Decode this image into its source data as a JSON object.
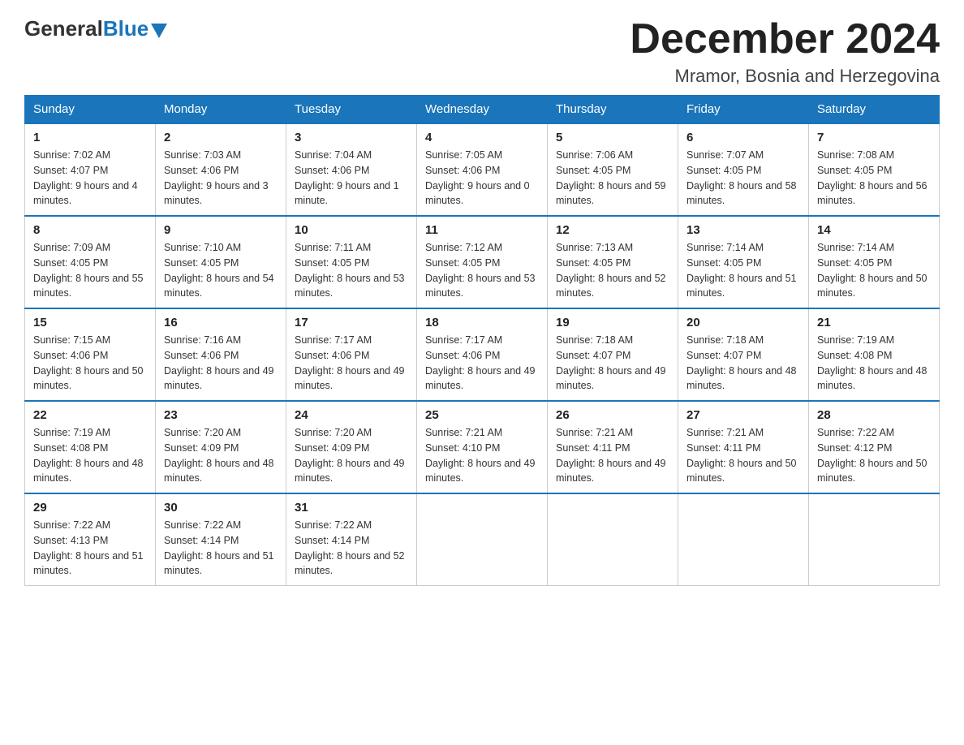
{
  "header": {
    "logo_general": "General",
    "logo_blue": "Blue",
    "month_title": "December 2024",
    "location": "Mramor, Bosnia and Herzegovina"
  },
  "days_of_week": [
    "Sunday",
    "Monday",
    "Tuesday",
    "Wednesday",
    "Thursday",
    "Friday",
    "Saturday"
  ],
  "weeks": [
    [
      {
        "day": "1",
        "sunrise": "7:02 AM",
        "sunset": "4:07 PM",
        "daylight": "9 hours and 4 minutes."
      },
      {
        "day": "2",
        "sunrise": "7:03 AM",
        "sunset": "4:06 PM",
        "daylight": "9 hours and 3 minutes."
      },
      {
        "day": "3",
        "sunrise": "7:04 AM",
        "sunset": "4:06 PM",
        "daylight": "9 hours and 1 minute."
      },
      {
        "day": "4",
        "sunrise": "7:05 AM",
        "sunset": "4:06 PM",
        "daylight": "9 hours and 0 minutes."
      },
      {
        "day": "5",
        "sunrise": "7:06 AM",
        "sunset": "4:05 PM",
        "daylight": "8 hours and 59 minutes."
      },
      {
        "day": "6",
        "sunrise": "7:07 AM",
        "sunset": "4:05 PM",
        "daylight": "8 hours and 58 minutes."
      },
      {
        "day": "7",
        "sunrise": "7:08 AM",
        "sunset": "4:05 PM",
        "daylight": "8 hours and 56 minutes."
      }
    ],
    [
      {
        "day": "8",
        "sunrise": "7:09 AM",
        "sunset": "4:05 PM",
        "daylight": "8 hours and 55 minutes."
      },
      {
        "day": "9",
        "sunrise": "7:10 AM",
        "sunset": "4:05 PM",
        "daylight": "8 hours and 54 minutes."
      },
      {
        "day": "10",
        "sunrise": "7:11 AM",
        "sunset": "4:05 PM",
        "daylight": "8 hours and 53 minutes."
      },
      {
        "day": "11",
        "sunrise": "7:12 AM",
        "sunset": "4:05 PM",
        "daylight": "8 hours and 53 minutes."
      },
      {
        "day": "12",
        "sunrise": "7:13 AM",
        "sunset": "4:05 PM",
        "daylight": "8 hours and 52 minutes."
      },
      {
        "day": "13",
        "sunrise": "7:14 AM",
        "sunset": "4:05 PM",
        "daylight": "8 hours and 51 minutes."
      },
      {
        "day": "14",
        "sunrise": "7:14 AM",
        "sunset": "4:05 PM",
        "daylight": "8 hours and 50 minutes."
      }
    ],
    [
      {
        "day": "15",
        "sunrise": "7:15 AM",
        "sunset": "4:06 PM",
        "daylight": "8 hours and 50 minutes."
      },
      {
        "day": "16",
        "sunrise": "7:16 AM",
        "sunset": "4:06 PM",
        "daylight": "8 hours and 49 minutes."
      },
      {
        "day": "17",
        "sunrise": "7:17 AM",
        "sunset": "4:06 PM",
        "daylight": "8 hours and 49 minutes."
      },
      {
        "day": "18",
        "sunrise": "7:17 AM",
        "sunset": "4:06 PM",
        "daylight": "8 hours and 49 minutes."
      },
      {
        "day": "19",
        "sunrise": "7:18 AM",
        "sunset": "4:07 PM",
        "daylight": "8 hours and 49 minutes."
      },
      {
        "day": "20",
        "sunrise": "7:18 AM",
        "sunset": "4:07 PM",
        "daylight": "8 hours and 48 minutes."
      },
      {
        "day": "21",
        "sunrise": "7:19 AM",
        "sunset": "4:08 PM",
        "daylight": "8 hours and 48 minutes."
      }
    ],
    [
      {
        "day": "22",
        "sunrise": "7:19 AM",
        "sunset": "4:08 PM",
        "daylight": "8 hours and 48 minutes."
      },
      {
        "day": "23",
        "sunrise": "7:20 AM",
        "sunset": "4:09 PM",
        "daylight": "8 hours and 48 minutes."
      },
      {
        "day": "24",
        "sunrise": "7:20 AM",
        "sunset": "4:09 PM",
        "daylight": "8 hours and 49 minutes."
      },
      {
        "day": "25",
        "sunrise": "7:21 AM",
        "sunset": "4:10 PM",
        "daylight": "8 hours and 49 minutes."
      },
      {
        "day": "26",
        "sunrise": "7:21 AM",
        "sunset": "4:11 PM",
        "daylight": "8 hours and 49 minutes."
      },
      {
        "day": "27",
        "sunrise": "7:21 AM",
        "sunset": "4:11 PM",
        "daylight": "8 hours and 50 minutes."
      },
      {
        "day": "28",
        "sunrise": "7:22 AM",
        "sunset": "4:12 PM",
        "daylight": "8 hours and 50 minutes."
      }
    ],
    [
      {
        "day": "29",
        "sunrise": "7:22 AM",
        "sunset": "4:13 PM",
        "daylight": "8 hours and 51 minutes."
      },
      {
        "day": "30",
        "sunrise": "7:22 AM",
        "sunset": "4:14 PM",
        "daylight": "8 hours and 51 minutes."
      },
      {
        "day": "31",
        "sunrise": "7:22 AM",
        "sunset": "4:14 PM",
        "daylight": "8 hours and 52 minutes."
      },
      null,
      null,
      null,
      null
    ]
  ]
}
